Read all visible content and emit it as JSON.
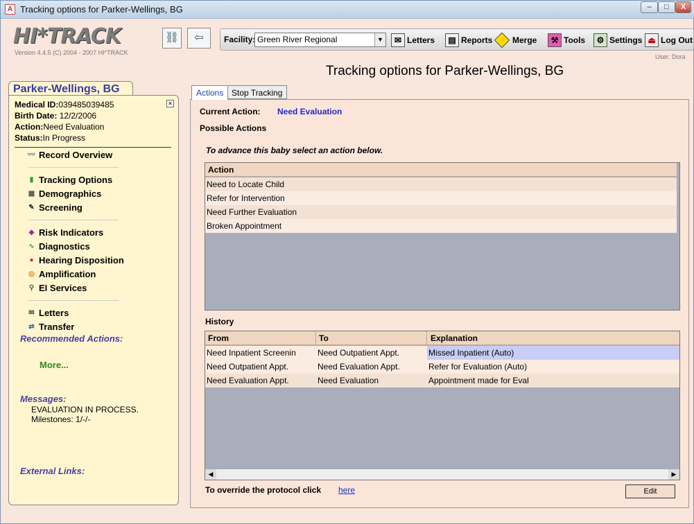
{
  "window": {
    "title": "Tracking options for Parker-Wellings, BG",
    "min": "–",
    "max": "□",
    "close": "X"
  },
  "app": {
    "logo": "HI*TRACK",
    "version": "Version 4.4.5 (C) 2004 - 2007 HI*TRACK"
  },
  "toolbar": {
    "facility_label": "Facility:",
    "facility_value": "Green River Regional",
    "buttons": [
      {
        "label": "Letters",
        "icon": "letter-icon"
      },
      {
        "label": "Reports",
        "icon": "reports-icon"
      },
      {
        "label": "Merge",
        "icon": "merge-icon"
      },
      {
        "label": "Tools",
        "icon": "tools-icon"
      },
      {
        "label": "Settings",
        "icon": "settings-icon"
      },
      {
        "label": "Log Out",
        "icon": "logout-icon"
      }
    ],
    "user": "User: Dora"
  },
  "page_title": "Tracking options for Parker-Wellings, BG",
  "patient": {
    "name": "Parker-Wellings, BG",
    "medical_id_label": "Medical ID:",
    "medical_id": "039485039485",
    "birth_label": "Birth Date:",
    "birth": "12/2/2006",
    "action_label": "Action:",
    "action": "Need Evaluation",
    "status_label": "Status:",
    "status": "In Progress"
  },
  "nav": {
    "record_overview": "Record Overview",
    "tracking_options": "Tracking Options",
    "demographics": "Demographics",
    "screening": "Screening",
    "risk_indicators": "Risk Indicators",
    "diagnostics": "Diagnostics",
    "hearing_disposition": "Hearing Disposition",
    "amplification": "Amplification",
    "ei_services": "EI Services",
    "letters": "Letters",
    "transfer": "Transfer"
  },
  "recommended": {
    "label": "Recommended Actions:",
    "more": "More..."
  },
  "messages": {
    "label": "Messages:",
    "line1": "EVALUATION IN PROCESS.",
    "line2": "Milestones: 1/-/-"
  },
  "external_links": "External Links:",
  "tabs": {
    "actions": "Actions",
    "stop": "Stop Tracking"
  },
  "current_action": {
    "label": "Current Action:",
    "value": "Need Evaluation"
  },
  "possible_actions_label": "Possible Actions",
  "advance_text": "To advance this baby select an action below.",
  "actions_grid": {
    "header": "Action",
    "rows": [
      "Need to Locate Child",
      "Refer for Intervention",
      "Need Further Evaluation",
      "Broken Appointment"
    ]
  },
  "history": {
    "label": "History",
    "headers": {
      "from": "From",
      "to": "To",
      "explanation": "Explanation"
    },
    "rows": [
      {
        "from": "Need Inpatient Screenin",
        "to": "Need Outpatient Appt.",
        "explanation": "Missed Inpatient (Auto)"
      },
      {
        "from": "Need Outpatient Appt.",
        "to": "Need Evaluation Appt.",
        "explanation": "Refer for Evaluation (Auto)"
      },
      {
        "from": "Need Evaluation Appt.",
        "to": "Need Evaluation",
        "explanation": "Appointment made for Eval"
      }
    ]
  },
  "override": {
    "text": "To override the protocol click",
    "link": "here",
    "edit": "Edit"
  },
  "colors": {
    "accent": "#1b2cc7",
    "selected_row": "#c8cdf5",
    "grid_bg": "#a9adbc",
    "sidebar_bg": "#fff6d0"
  }
}
